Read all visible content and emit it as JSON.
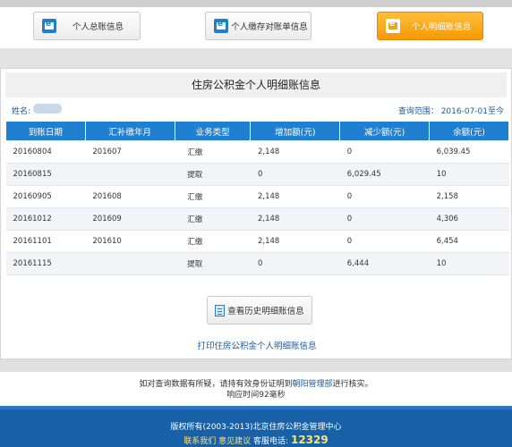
{
  "nav": {
    "buttons": [
      {
        "label": "个人总账信息",
        "active": false
      },
      {
        "label": "个人缴存对账单信息",
        "active": false
      },
      {
        "label": "个人明细账信息",
        "active": true
      }
    ]
  },
  "panel": {
    "title": "住房公积金个人明细账信息",
    "name_label": "姓名:",
    "query_range": "查询范围：   2016-07-01至今"
  },
  "table": {
    "headers": [
      "到账日期",
      "汇补缴年月",
      "业务类型",
      "增加额(元)",
      "减少额(元)",
      "余额(元)"
    ],
    "rows": [
      [
        "20160804",
        "201607",
        "汇缴",
        "2,148",
        "0",
        "6,039.45"
      ],
      [
        "20160815",
        "",
        "提取",
        "0",
        "6,029.45",
        "10"
      ],
      [
        "20160905",
        "201608",
        "汇缴",
        "2,148",
        "0",
        "2,158"
      ],
      [
        "20161012",
        "201609",
        "汇缴",
        "2,148",
        "0",
        "4,306"
      ],
      [
        "20161101",
        "201610",
        "汇缴",
        "2,148",
        "0",
        "6,454"
      ],
      [
        "20161115",
        "",
        "提取",
        "0",
        "6,444",
        "10"
      ]
    ]
  },
  "history_button": "查看历史明细账信息",
  "print_link": "打印住房公积金个人明细账信息",
  "notice": {
    "pre": "如对查询数据有所疑，请持有效身份证明到",
    "link": "朝阳管理部",
    "post": "进行核实。",
    "response": "响应时间92毫秒"
  },
  "footer": {
    "copyright": "版权所有(2003-2013)北京住房公积金管理中心",
    "contact": "联系我们",
    "feedback": "意见建议",
    "phone_label": "客服电话:",
    "phone": "12329"
  },
  "colors": {
    "header_blue": "#1f7fd0",
    "active_orange": "#f59a05",
    "footer_blue": "#1861a8"
  }
}
